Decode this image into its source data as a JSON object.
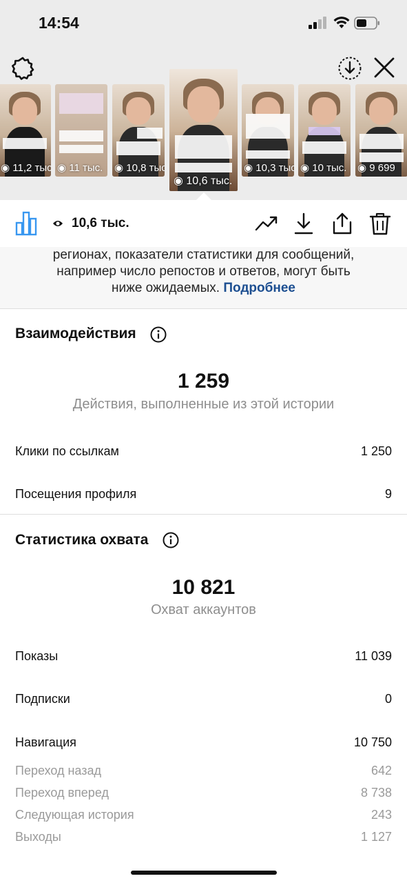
{
  "status_bar": {
    "time": "14:54"
  },
  "stories": {
    "thumbnails": [
      {
        "views": "11,2 тыс."
      },
      {
        "views": "11 тыс."
      },
      {
        "views": "10,8 тыс."
      },
      {
        "views": "10,6 тыс.",
        "selected": true
      },
      {
        "views": "10,3 тыс."
      },
      {
        "views": "10 тыс."
      },
      {
        "views": "9 699"
      }
    ]
  },
  "action_bar": {
    "views": "10,6 тыс."
  },
  "notice": {
    "line1": "регионах, показатели статистики для сообщений,",
    "line2": "например число репостов и ответов, могут быть",
    "line3": "ниже ожидаемых.",
    "link": "Подробнее"
  },
  "interactions": {
    "title": "Взаимодействия",
    "total": "1 259",
    "subtitle": "Действия, выполненные из этой истории",
    "rows": [
      {
        "label": "Клики по ссылкам",
        "value": "1 250"
      },
      {
        "label": "Посещения профиля",
        "value": "9"
      }
    ]
  },
  "reach": {
    "title": "Статистика охвата",
    "total": "10 821",
    "subtitle": "Охват аккаунтов",
    "rows": [
      {
        "label": "Показы",
        "value": "11 039"
      },
      {
        "label": "Подписки",
        "value": "0"
      },
      {
        "label": "Навигация",
        "value": "10 750"
      }
    ],
    "navigation": [
      {
        "label": "Переход назад",
        "value": "642"
      },
      {
        "label": "Переход вперед",
        "value": "8 738"
      },
      {
        "label": "Следующая история",
        "value": "243"
      },
      {
        "label": "Выходы",
        "value": "1 127"
      }
    ]
  },
  "colors": {
    "accent": "#3897f0",
    "link": "#1d4f91",
    "muted": "#8e8e8e"
  }
}
